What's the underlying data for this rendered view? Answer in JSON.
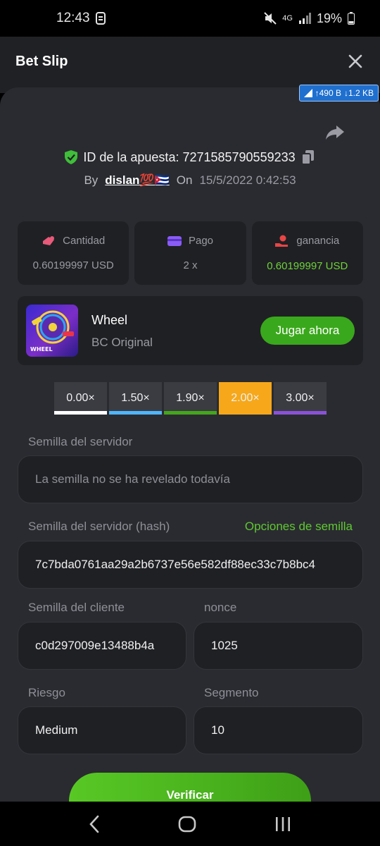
{
  "status": {
    "time": "12:43",
    "battery": "19%",
    "network": "4G"
  },
  "header": {
    "title": "Bet Slip"
  },
  "net_badge": {
    "up": "↑490 B",
    "down": "↓1.2 KB"
  },
  "bet": {
    "id_label": "ID de la apuesta: 7271585790559233",
    "by_label": "By",
    "user": "dislan💯🇨🇺",
    "on_label": "On",
    "date": "15/5/2022 0:42:53"
  },
  "stats": [
    {
      "label": "Cantidad",
      "value": "0.60199997 USD",
      "color": "#e85a7a"
    },
    {
      "label": "Pago",
      "value": "2 x",
      "color": "#8a5cf6"
    },
    {
      "label": "ganancia",
      "value": "0.60199997 USD",
      "color": "#e84545"
    }
  ],
  "game": {
    "name": "Wheel",
    "subtitle": "BC Original",
    "play_label": "Jugar ahora",
    "thumb_text": "WHEEL"
  },
  "multipliers": [
    {
      "label": "0.00×",
      "color": "#ffffff",
      "selected": false
    },
    {
      "label": "1.50×",
      "color": "#4fb6ff",
      "selected": false
    },
    {
      "label": "1.90×",
      "color": "#45a71b",
      "selected": false
    },
    {
      "label": "2.00×",
      "color": "#f6a81a",
      "selected": true
    },
    {
      "label": "3.00×",
      "color": "#8a52d8",
      "selected": false
    }
  ],
  "fields": {
    "server_seed_label": "Semilla del servidor",
    "server_seed_value": "La semilla no se ha revelado todavía",
    "server_hash_label": "Semilla del servidor (hash)",
    "seed_options_label": "Opciones de semilla",
    "server_hash_value": "7c7bda0761aa29a2b6737e56e582df88ec33c7b8bc4",
    "client_seed_label": "Semilla del cliente",
    "client_seed_value": "c0d297009e13488b4a",
    "nonce_label": "nonce",
    "nonce_value": "1025",
    "risk_label": "Riesgo",
    "risk_value": "Medium",
    "segment_label": "Segmento",
    "segment_value": "10"
  },
  "verify_label": "Verificar"
}
